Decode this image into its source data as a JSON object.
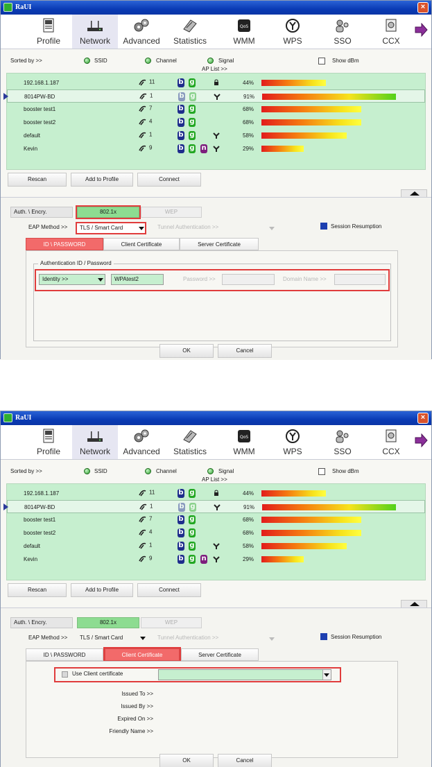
{
  "title": "RaUI",
  "close_glyph": "×",
  "toolbar": [
    {
      "label": "Profile",
      "icon": "profile-icon"
    },
    {
      "label": "Network",
      "icon": "network-icon",
      "active": true
    },
    {
      "label": "Advanced",
      "icon": "advanced-icon"
    },
    {
      "label": "Statistics",
      "icon": "statistics-icon"
    },
    {
      "label": "WMM",
      "icon": "wmm-icon"
    },
    {
      "label": "WPS",
      "icon": "wps-icon"
    },
    {
      "label": "SSO",
      "icon": "sso-icon"
    },
    {
      "label": "CCX",
      "icon": "ccx-icon"
    }
  ],
  "sort": {
    "label": "Sorted by >>",
    "ssid": "SSID",
    "channel": "Channel",
    "signal": "Signal",
    "show_dbm": "Show dBm",
    "ap_list": "AP List >>"
  },
  "ap_list": [
    {
      "ssid": "192.168.1.187",
      "channel": "11",
      "b": true,
      "g": true,
      "n": false,
      "sec": "lock",
      "signal": "44%",
      "level": 0.44
    },
    {
      "ssid": "8014PW-BD",
      "channel": "1",
      "b": true,
      "g": true,
      "n": false,
      "sec": "wps",
      "signal": "91%",
      "level": 0.91,
      "selected": true
    },
    {
      "ssid": "booster test1",
      "channel": "7",
      "b": true,
      "g": true,
      "n": false,
      "sec": "",
      "signal": "68%",
      "level": 0.68
    },
    {
      "ssid": "booster test2",
      "channel": "4",
      "b": true,
      "g": true,
      "n": false,
      "sec": "",
      "signal": "68%",
      "level": 0.68
    },
    {
      "ssid": "default",
      "channel": "1",
      "b": true,
      "g": true,
      "n": false,
      "sec": "wps",
      "signal": "58%",
      "level": 0.58
    },
    {
      "ssid": "Kevin",
      "channel": "9",
      "b": true,
      "g": true,
      "n": true,
      "sec": "wps",
      "signal": "29%",
      "level": 0.29
    }
  ],
  "buttons": {
    "rescan": "Rescan",
    "add_to_profile": "Add to Profile",
    "connect": "Connect",
    "ok": "OK",
    "cancel": "Cancel"
  },
  "auth": {
    "label": "Auth. \\ Encry.",
    "value": "802.1x",
    "disabled_value": "WEP"
  },
  "eap": {
    "label": "EAP Method >>",
    "value": "TLS / Smart Card",
    "tunnel_label": "Tunnel Authentication >>",
    "session_resumption": "Session Resumption"
  },
  "tabs": {
    "id_password": "ID \\ PASSWORD",
    "client_certificate": "Client Certificate",
    "server_certificate": "Server Certificate"
  },
  "shot1": {
    "group_title": "Authentication ID / Password",
    "identity_label": "Identity >>",
    "identity_value": "WPAtest2",
    "password_label": "Password >>",
    "domain_label": "Domain Name >>"
  },
  "shot2": {
    "use_client_cert": "Use Client certificate",
    "issued_to": "Issued To >>",
    "issued_by": "Issued By >>",
    "expired_on": "Expired On >>",
    "friendly_name": "Friendly Name >>"
  },
  "colors": {
    "list_bg": "#c6efcf",
    "active_green": "#8ddc91",
    "highlight_red": "#e03c3c",
    "active_tab": "#f26a6a",
    "badge_b": "#1e2d8c",
    "badge_g": "#22a722",
    "badge_n": "#7d1e7d"
  }
}
